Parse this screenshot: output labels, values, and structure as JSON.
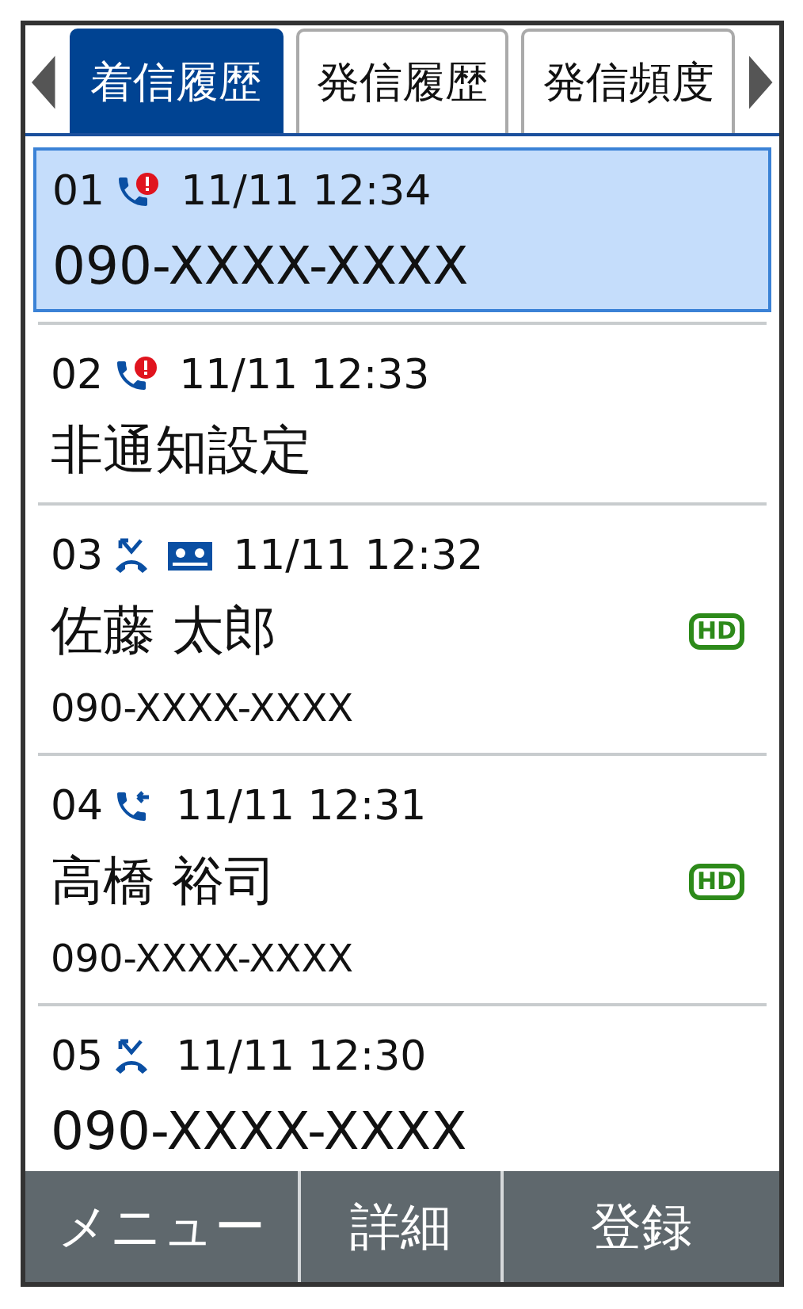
{
  "tabs": [
    {
      "label": "着信履歴",
      "selected": true
    },
    {
      "label": "発信履歴",
      "selected": false
    },
    {
      "label": "発信頻度",
      "selected": false
    }
  ],
  "calls": [
    {
      "index": "01",
      "icons": [
        {
          "kind": "missed"
        }
      ],
      "time": "11/11 12:34",
      "title": "090-XXXX-XXXX",
      "selected": true
    },
    {
      "index": "02",
      "icons": [
        {
          "kind": "missed"
        }
      ],
      "time": "11/11 12:33",
      "title": "非通知設定",
      "selected": false
    },
    {
      "index": "03",
      "icons": [
        {
          "kind": "rejected"
        },
        {
          "kind": "voicemail"
        }
      ],
      "time": "11/11 12:32",
      "title": "佐藤 太郎",
      "number": "090-XXXX-XXXX",
      "badge": "HD",
      "selected": false
    },
    {
      "index": "04",
      "icons": [
        {
          "kind": "incoming"
        }
      ],
      "time": "11/11 12:31",
      "title": "高橋 裕司",
      "number": "090-XXXX-XXXX",
      "badge": "HD",
      "selected": false
    },
    {
      "index": "05",
      "icons": [
        {
          "kind": "rejected"
        }
      ],
      "time": "11/11 12:30",
      "title": "090-XXXX-XXXX",
      "selected": false
    }
  ],
  "softkeys": [
    "メニュー",
    "詳細",
    "登録"
  ]
}
